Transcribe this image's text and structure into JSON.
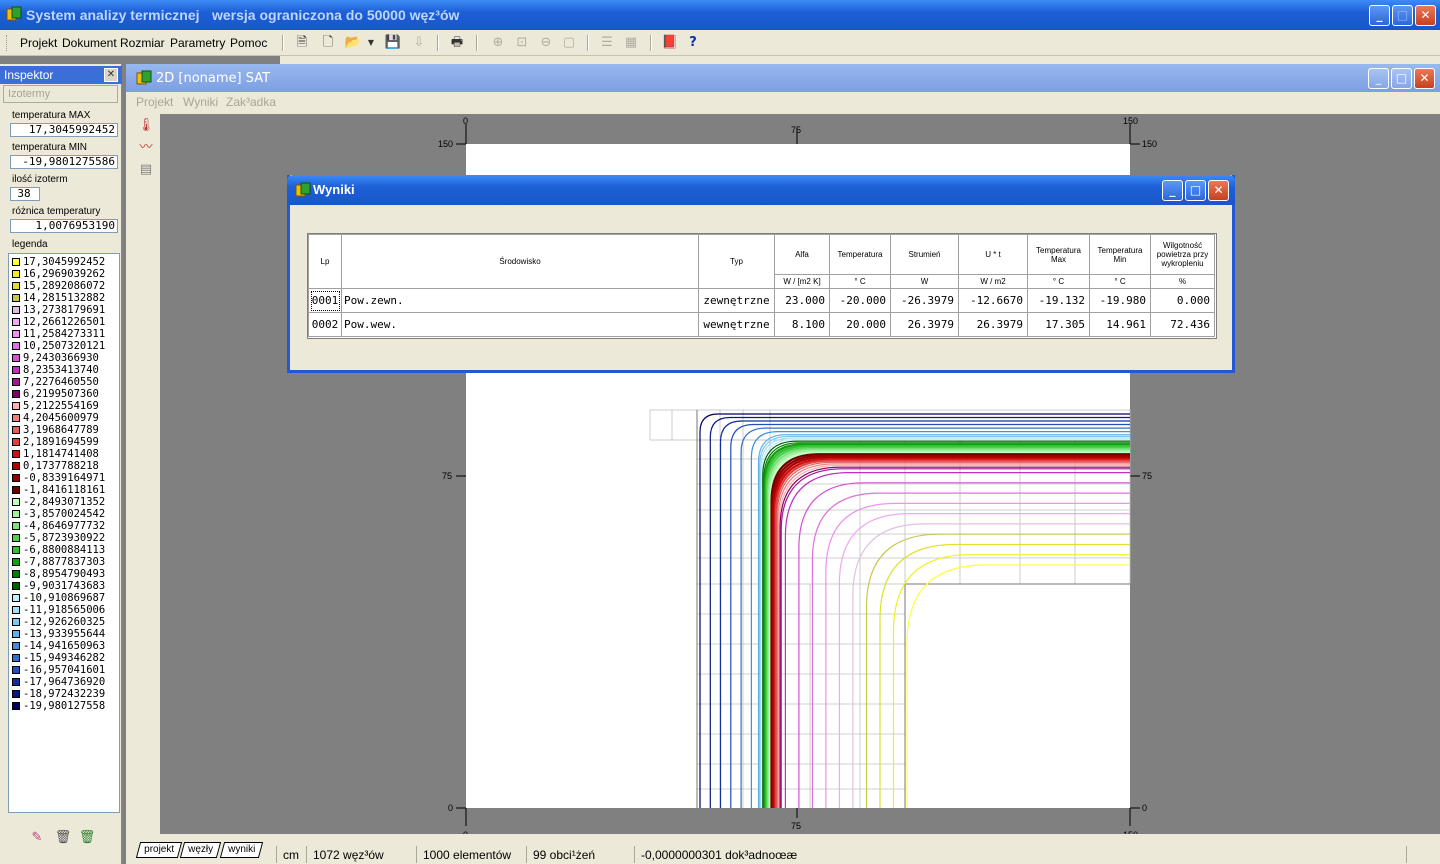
{
  "app": {
    "title": "System analizy termicznej",
    "subtitle": "wersja ograniczona do 50000 węz³ów",
    "window_buttons": {
      "minimize": "_",
      "maximize": "□",
      "close": "✕"
    }
  },
  "menu": [
    "Projekt",
    "Dokument",
    "Rozmiar",
    "Parametry",
    "Pomoc"
  ],
  "toolbar_icons": [
    "new-doc-icon",
    "new-doc2-icon",
    "open-folder-icon",
    "dropdown-icon",
    "save-icon",
    "export-icon",
    "print-icon",
    "zoom-in-icon",
    "zoom-fit-icon",
    "zoom-out-icon",
    "zoom-window-icon",
    "list-icon",
    "calc-icon",
    "book-icon",
    "help-icon"
  ],
  "inspector": {
    "title": "Inspektor",
    "tab": "Izotermy",
    "fields": [
      {
        "label": "temperatura MAX",
        "value": "17,3045992452"
      },
      {
        "label": "temperatura MIN",
        "value": "-19,9801275586"
      },
      {
        "label": "ilość izoterm",
        "value": "38"
      },
      {
        "label": "różnica temperatury",
        "value": "1,0076953190"
      }
    ],
    "legend_title": "legenda",
    "legend": [
      {
        "value": "17,3045992452",
        "color": "#ffff40"
      },
      {
        "value": "16,2969039262",
        "color": "#f0f020"
      },
      {
        "value": "15,2892086072",
        "color": "#e0e030"
      },
      {
        "value": "14,2815132882",
        "color": "#c8c850"
      },
      {
        "value": "13,2738179691",
        "color": "#e0c0e0"
      },
      {
        "value": "12,2661226501",
        "color": "#f0a8f0"
      },
      {
        "value": "11,2584273311",
        "color": "#f090f0"
      },
      {
        "value": "10,2507320121",
        "color": "#e070e0"
      },
      {
        "value": "9,2430366930",
        "color": "#d850d8"
      },
      {
        "value": "8,2353413740",
        "color": "#c030c0"
      },
      {
        "value": "7,2276460550",
        "color": "#a01890"
      },
      {
        "value": "6,2199507360",
        "color": "#800060"
      },
      {
        "value": "5,2122554169",
        "color": "#ffb0b0"
      },
      {
        "value": "4,2045600979",
        "color": "#f08080"
      },
      {
        "value": "3,1968647789",
        "color": "#e06060"
      },
      {
        "value": "2,1891694599",
        "color": "#e04040"
      },
      {
        "value": "1,1814741408",
        "color": "#d01010"
      },
      {
        "value": "0,1737788218",
        "color": "#b00000"
      },
      {
        "value": "-0,8339164971",
        "color": "#900000"
      },
      {
        "value": "-1,8416118161",
        "color": "#700000"
      },
      {
        "value": "-2,8493071352",
        "color": "#c0ffc0"
      },
      {
        "value": "-3,8570024542",
        "color": "#a0f0a0"
      },
      {
        "value": "-4,8646977732",
        "color": "#80e080"
      },
      {
        "value": "-5,8723930922",
        "color": "#50d050"
      },
      {
        "value": "-6,8800884113",
        "color": "#30c030"
      },
      {
        "value": "-7,8877837303",
        "color": "#10a010"
      },
      {
        "value": "-8,8954790493",
        "color": "#008000"
      },
      {
        "value": "-9,9031743683",
        "color": "#006000"
      },
      {
        "value": "-10,910869687",
        "color": "#c0f0ff"
      },
      {
        "value": "-11,918565006",
        "color": "#a0e0f8"
      },
      {
        "value": "-12,926260325",
        "color": "#80c8f0"
      },
      {
        "value": "-13,933955644",
        "color": "#60b0e8"
      },
      {
        "value": "-14,941650963",
        "color": "#4090d8"
      },
      {
        "value": "-15,949346282",
        "color": "#3070c8"
      },
      {
        "value": "-16,957041601",
        "color": "#2050b8"
      },
      {
        "value": "-17,964736920",
        "color": "#1030a0"
      },
      {
        "value": "-18,972432239",
        "color": "#081880"
      },
      {
        "value": "-19,980127558",
        "color": "#000060"
      }
    ]
  },
  "child": {
    "title": "2D   [noname]  SAT",
    "menu": [
      "Projekt",
      "Wyniki",
      "Zak³adka"
    ],
    "ruler_labels": {
      "left": "0",
      "mid": "75",
      "right": "150"
    }
  },
  "dialog": {
    "title": "Wyniki",
    "headers": [
      "Lp",
      "Środowisko",
      "Typ",
      "Alfa",
      "Temperatura",
      "Strumień",
      "U * t",
      "Temperatura Max",
      "Temperatura Min",
      "Wilgotność powietrza przy wykropleniu"
    ],
    "units": [
      "W / [m2  K]",
      "° C",
      "W",
      "W / m2",
      "° C",
      "° C",
      "%"
    ],
    "rows": [
      [
        "0001",
        "Pow.zewn.",
        "zewnętrzne",
        "23.000",
        "-20.000",
        "-26.3979",
        "-12.6670",
        "-19.132",
        "-19.980",
        "0.000"
      ],
      [
        "0002",
        "Pow.wew.",
        "wewnętrzne",
        "8.100",
        "20.000",
        "26.3979",
        "26.3979",
        "17.305",
        "14.961",
        "72.436"
      ]
    ]
  },
  "bottom_tabs": [
    "projekt",
    "węzły",
    "wyniki"
  ],
  "status": [
    "cm",
    "1072 węz³ów",
    "1000 elementów",
    "99 obci¹żeń",
    "-0,0000000301 dok³adnoœæ"
  ]
}
